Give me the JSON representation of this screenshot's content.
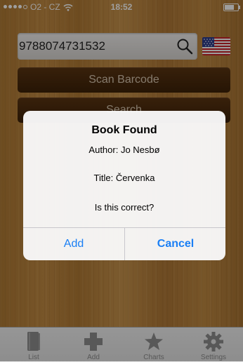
{
  "status_bar": {
    "carrier": "O2 - CZ",
    "time": "18:52",
    "battery_level": 0.8
  },
  "search": {
    "isbn_value": "9788074731532",
    "icon": "search-icon",
    "flag_icon": "us-flag-icon"
  },
  "buttons": {
    "scan_label": "Scan Barcode",
    "search_label": "Search"
  },
  "alert": {
    "title": "Book Found",
    "author": "Author: Jo Nesbø",
    "book_title": "Title: Červenka",
    "question": "Is this correct?",
    "add_label": "Add",
    "cancel_label": "Cancel"
  },
  "tabs": [
    {
      "label": "List",
      "icon": "book-icon"
    },
    {
      "label": "Add",
      "icon": "plus-icon"
    },
    {
      "label": "Charts",
      "icon": "star-icon"
    },
    {
      "label": "Settings",
      "icon": "gear-icon"
    }
  ],
  "colors": {
    "accent": "#1a7ff5",
    "button_bg": "#4a2a0d",
    "tab_icon": "#8e8e8e"
  }
}
